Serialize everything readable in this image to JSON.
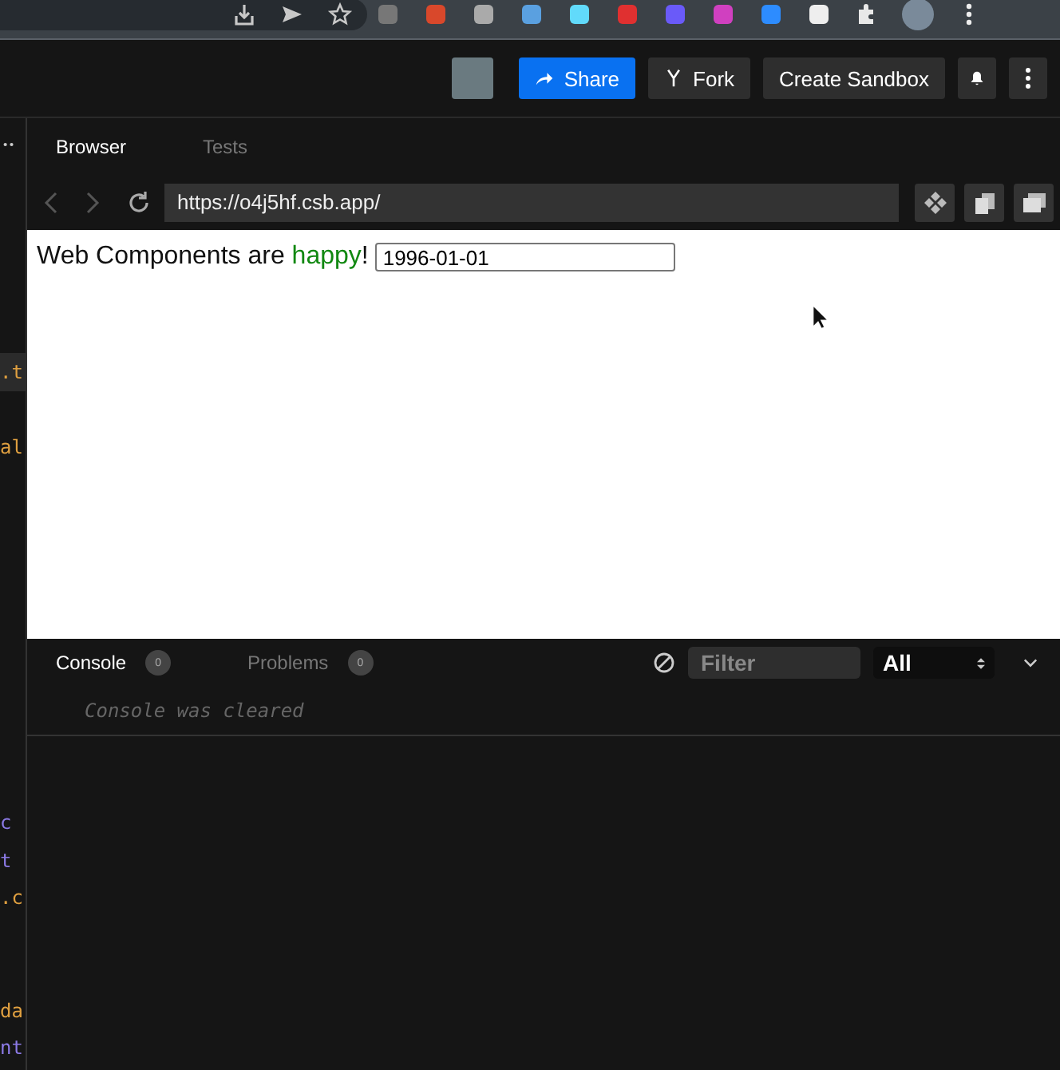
{
  "header": {
    "share": "Share",
    "fork": "Fork",
    "create": "Create Sandbox"
  },
  "editor_fragments": [
    {
      "text": ".t",
      "color": "#e0a040"
    },
    {
      "text": "al",
      "color": "#e0a040"
    },
    {
      "text": "c",
      "color": "#8c7ae6"
    },
    {
      "text": "t",
      "color": "#8c7ae6"
    },
    {
      "text": ".c",
      "color": "#e0a040"
    },
    {
      "text": "da",
      "color": "#e0a040"
    },
    {
      "text": "nt",
      "color": "#8c7ae6"
    }
  ],
  "preview_tabs": [
    {
      "label": "Browser",
      "selected": true
    },
    {
      "label": "Tests",
      "selected": false
    }
  ],
  "address": {
    "url": "https://o4j5hf.csb.app/"
  },
  "page": {
    "text": "Web Components are",
    "highlight": "happy",
    "after": "!",
    "date_value": "1996-01-01"
  },
  "console_tabs": [
    {
      "label": "Console",
      "count": "0",
      "selected": true
    },
    {
      "label": "Problems",
      "count": "0",
      "selected": false
    }
  ],
  "filter": {
    "placeholder": "Filter",
    "level": "All"
  },
  "console_messages": [
    "Console was cleared"
  ]
}
